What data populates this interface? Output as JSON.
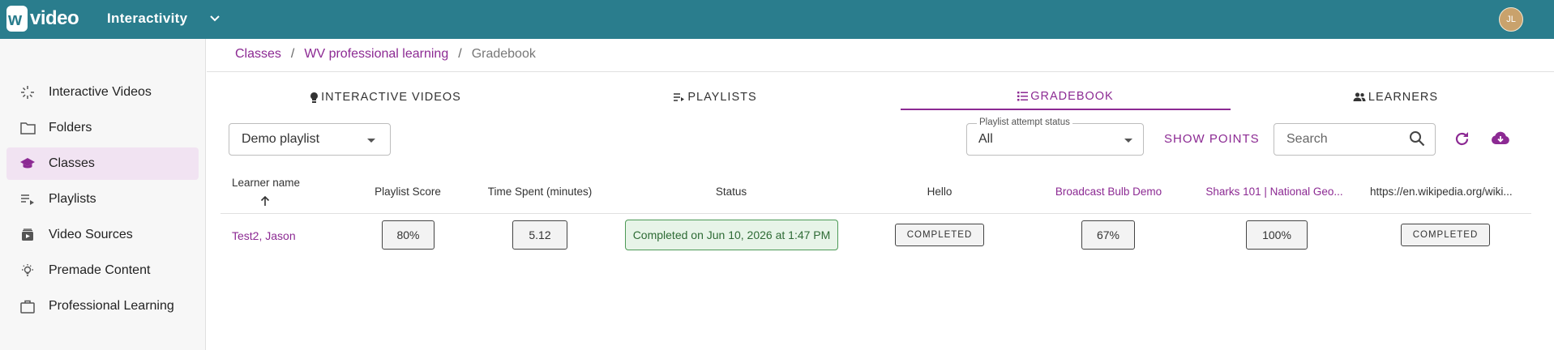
{
  "header": {
    "logo_text": "wevideo",
    "app_title": "Interactivity",
    "avatar_initials": "JL"
  },
  "sidebar": {
    "items": [
      {
        "label": "Interactive Videos",
        "icon": "sparkle-cursor-icon",
        "active": false
      },
      {
        "label": "Folders",
        "icon": "folder-icon",
        "active": false
      },
      {
        "label": "Classes",
        "icon": "graduation-cap-icon",
        "active": true
      },
      {
        "label": "Playlists",
        "icon": "playlist-icon",
        "active": false
      },
      {
        "label": "Video Sources",
        "icon": "video-library-icon",
        "active": false
      },
      {
        "label": "Premade Content",
        "icon": "lightbulb-icon",
        "active": false
      },
      {
        "label": "Professional Learning",
        "icon": "briefcase-icon",
        "active": false
      }
    ]
  },
  "breadcrumb": {
    "items": [
      "Classes",
      "WV professional learning"
    ],
    "current": "Gradebook",
    "separator": "/"
  },
  "tabs": [
    {
      "label": "INTERACTIVE VIDEOS",
      "icon": "lightbulb-icon",
      "active": false
    },
    {
      "label": "PLAYLISTS",
      "icon": "playlist-play-icon",
      "active": false
    },
    {
      "label": "GRADEBOOK",
      "icon": "list-icon",
      "active": true
    },
    {
      "label": "LEARNERS",
      "icon": "people-icon",
      "active": false
    }
  ],
  "controls": {
    "playlist_select_value": "Demo playlist",
    "status_filter_label": "Playlist attempt status",
    "status_filter_value": "All",
    "show_points_label": "SHOW POINTS",
    "search_placeholder": "Search"
  },
  "table": {
    "columns": [
      {
        "label": "Learner name",
        "sort": "ascending"
      },
      {
        "label": "Playlist Score"
      },
      {
        "label": "Time Spent (minutes)"
      },
      {
        "label": "Status"
      },
      {
        "label": "Hello"
      },
      {
        "label": "Broadcast Bulb Demo",
        "link": true
      },
      {
        "label": "Sharks 101 | National Geo...",
        "link": true
      },
      {
        "label": "https://en.wikipedia.org/wiki..."
      }
    ],
    "rows": [
      {
        "learner": "Test2, Jason",
        "playlist_score": "80%",
        "time_spent": "5.12",
        "status": "Completed on Jun 10, 2026 at 1:47 PM",
        "hello": "COMPLETED",
        "broadcast_bulb_demo": "67%",
        "sharks_101": "100%",
        "wikipedia": "COMPLETED"
      }
    ]
  },
  "colors": {
    "header_bg": "#2a7d8d",
    "accent": "#8c2a93",
    "active_nav_bg": "#f1e3f2",
    "status_green": "#4c9a56"
  }
}
